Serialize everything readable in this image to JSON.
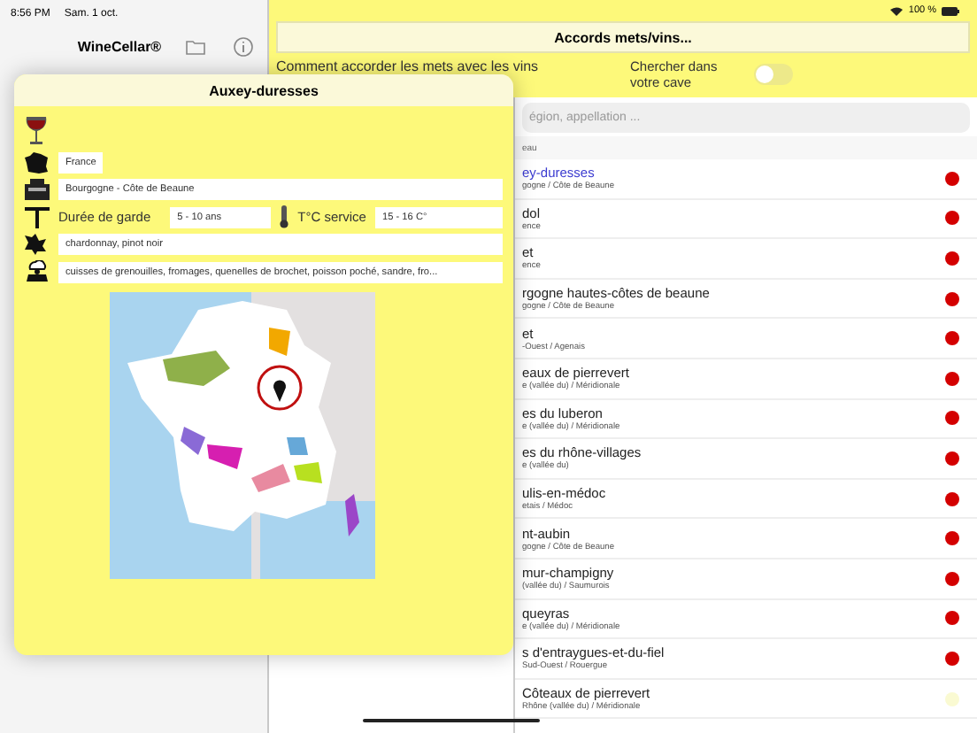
{
  "status_bar": {
    "time": "8:56 PM",
    "date": "Sam. 1 oct.",
    "battery": "100 %"
  },
  "sidebar": {
    "title": "WineCellar®"
  },
  "main": {
    "title": "Accords mets/vins...",
    "pairing_link": "Comment accorder les mets avec les vins",
    "cave_toggle": {
      "label": "Chercher dans votre cave",
      "on": false
    },
    "search": {
      "placeholder": "égion, appellation ..."
    },
    "section_header": "eau",
    "wines": [
      {
        "name": "ey-duresses",
        "region": "gogne / Côte de Beaune",
        "selected": true,
        "color": "#d40000"
      },
      {
        "name": "dol",
        "region": "ence",
        "selected": false,
        "color": "#d40000"
      },
      {
        "name": "et",
        "region": "ence",
        "selected": false,
        "color": "#d40000"
      },
      {
        "name": "rgogne hautes-côtes de beaune",
        "region": "gogne / Côte de Beaune",
        "selected": false,
        "color": "#d40000"
      },
      {
        "name": "et",
        "region": "-Ouest / Agenais",
        "selected": false,
        "color": "#d40000"
      },
      {
        "name": "eaux de pierrevert",
        "region": "e (vallée du) / Méridionale",
        "selected": false,
        "color": "#d40000"
      },
      {
        "name": "es du luberon",
        "region": "e (vallée du) / Méridionale",
        "selected": false,
        "color": "#d40000"
      },
      {
        "name": "es du rhône-villages",
        "region": "e (vallée du)",
        "selected": false,
        "color": "#d40000"
      },
      {
        "name": "ulis-en-médoc",
        "region": "etais / Médoc",
        "selected": false,
        "color": "#d40000"
      },
      {
        "name": "nt-aubin",
        "region": "gogne / Côte de Beaune",
        "selected": false,
        "color": "#d40000"
      },
      {
        "name": "mur-champigny",
        "region": "(vallée du) / Saumurois",
        "selected": false,
        "color": "#d40000"
      },
      {
        "name": "queyras",
        "region": "e (vallée du) / Méridionale",
        "selected": false,
        "color": "#d40000"
      },
      {
        "name": "s d'entraygues-et-du-fiel",
        "region": "Sud-Ouest / Rouergue",
        "selected": false,
        "color": "#d40000"
      },
      {
        "name": "Côteaux de pierrevert",
        "region": "Rhône (vallée du) / Méridionale",
        "selected": false,
        "color": "#fafad2"
      }
    ]
  },
  "popover": {
    "title": "Auxey-duresses",
    "country": "France",
    "region": "Bourgogne - Côte de Beaune",
    "aging_label": "Durée de garde",
    "aging": "5 - 10 ans",
    "temp_label": "T°C service",
    "temp": "15 - 16 C°",
    "grapes": "chardonnay, pinot noir",
    "dishes": "cuisses de grenouilles, fromages, quenelles de brochet, poisson poché, sandre, fro..."
  }
}
